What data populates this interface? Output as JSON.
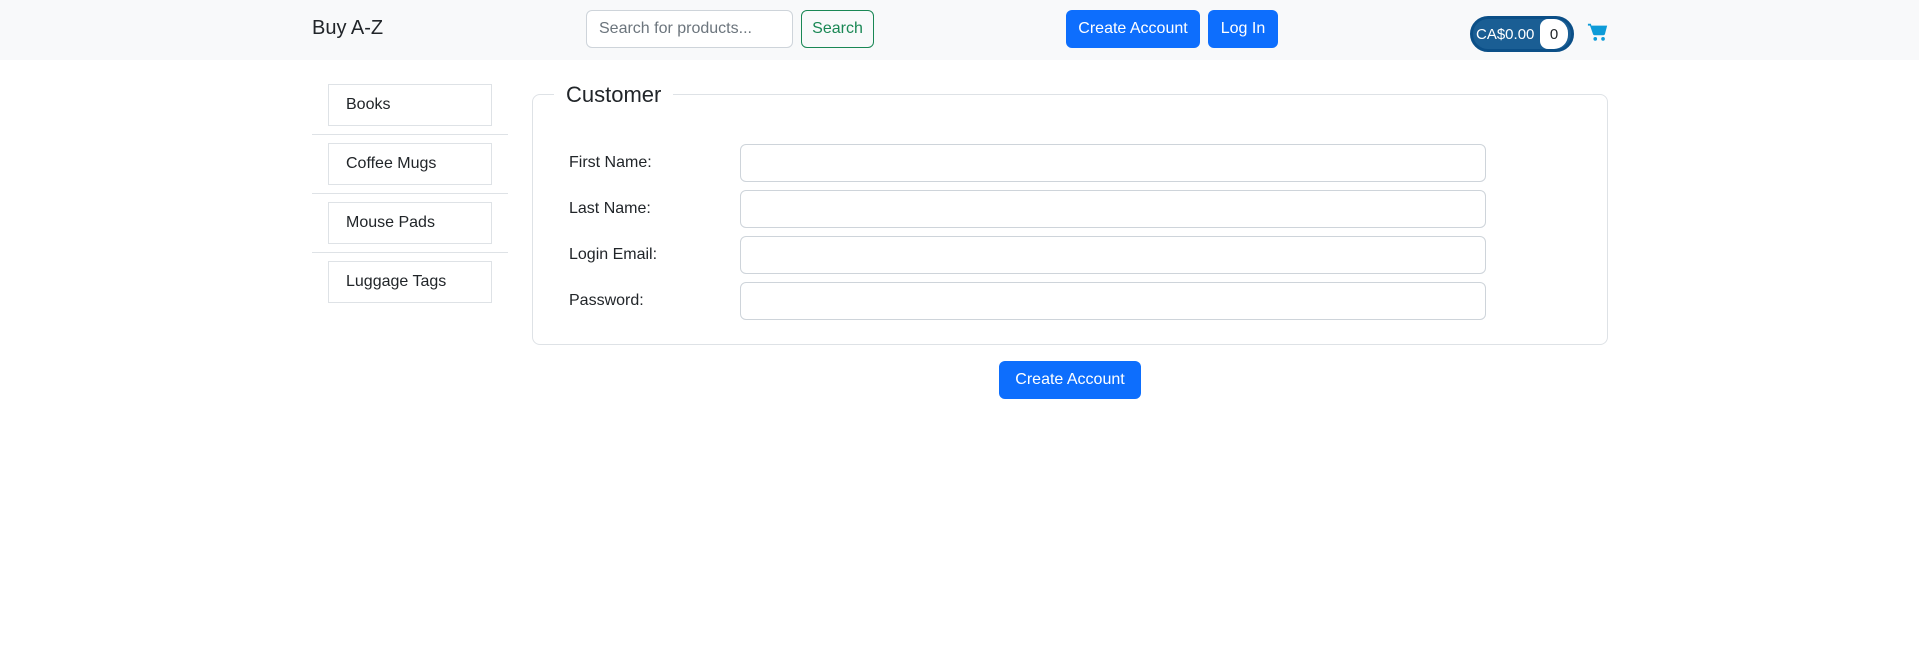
{
  "header": {
    "brand": "Buy A-Z",
    "search_placeholder": "Search for products...",
    "search_label": "Search",
    "create_account_label": "Create Account",
    "login_label": "Log In",
    "cart_total": "CA$0.00",
    "cart_count": "0",
    "cart_icon": "shopping-cart-icon"
  },
  "sidebar": {
    "items": [
      {
        "label": "Books"
      },
      {
        "label": "Coffee Mugs"
      },
      {
        "label": "Mouse Pads"
      },
      {
        "label": "Luggage Tags"
      }
    ]
  },
  "form": {
    "legend": "Customer",
    "fields": [
      {
        "label": "First Name:",
        "value": ""
      },
      {
        "label": "Last Name:",
        "value": ""
      },
      {
        "label": "Login Email:",
        "value": ""
      },
      {
        "label": "Password:",
        "value": ""
      }
    ],
    "submit_label": "Create Account"
  },
  "colors": {
    "primary": "#0d6efd",
    "success": "#198754",
    "cart_pill": "#1a5e94",
    "cart_icon": "#0d9bd8"
  }
}
